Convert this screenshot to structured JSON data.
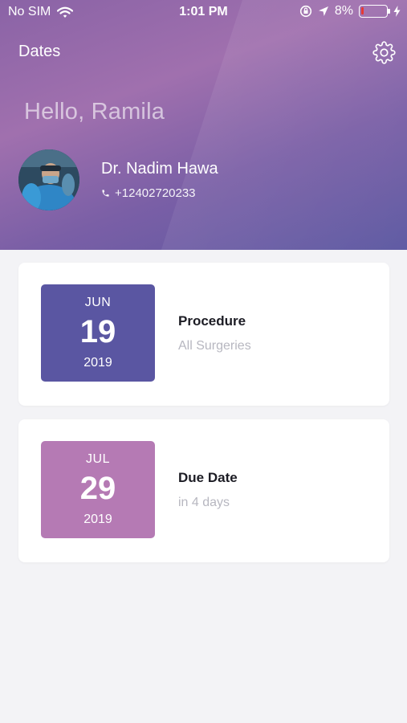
{
  "status_bar": {
    "carrier": "No SIM",
    "time": "1:01 PM",
    "battery_text": "8%",
    "battery_level": 0.08,
    "battery_color": "#e53935"
  },
  "header": {
    "title": "Dates",
    "settings_icon": "gear-icon",
    "greeting": "Hello, Ramila",
    "gradient_colors": [
      "#a070ae",
      "#5b57a1"
    ]
  },
  "doctor": {
    "name": "Dr. Nadim Hawa",
    "phone": "+12402720233",
    "phone_icon": "phone-icon"
  },
  "dates": [
    {
      "month": "JUN",
      "day": "19",
      "year": "2019",
      "title": "Procedure",
      "subtitle": "All Surgeries",
      "color": "#5a56a2"
    },
    {
      "month": "JUL",
      "day": "29",
      "year": "2019",
      "title": "Due Date",
      "subtitle": "in 4 days",
      "color": "#b57ab4"
    }
  ]
}
